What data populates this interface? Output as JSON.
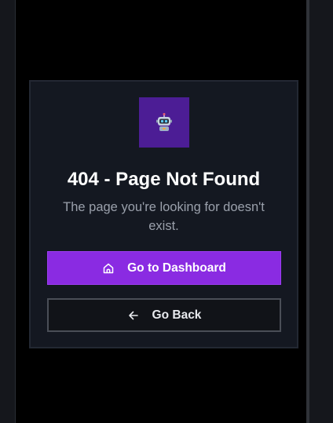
{
  "error_card": {
    "logo_icon": "robot-icon",
    "title": "404 - Page Not Found",
    "message": "The page you're looking for doesn't exist.",
    "primary_button": {
      "label": "Go to Dashboard",
      "icon": "home-icon"
    },
    "secondary_button": {
      "label": "Go Back",
      "icon": "arrow-left-icon"
    }
  },
  "colors": {
    "accent": "#8a2be2",
    "logo_background": "#4c1d95",
    "card_background": "#141821",
    "page_background": "#000000"
  }
}
